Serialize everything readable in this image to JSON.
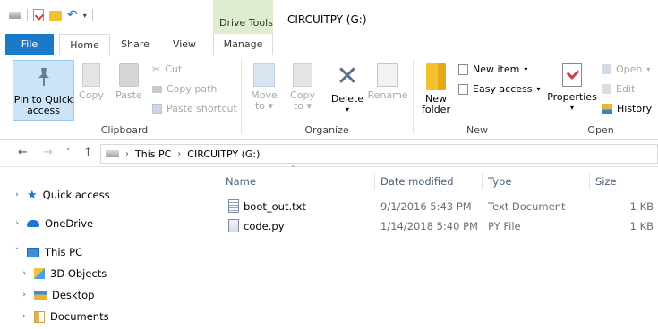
{
  "window": {
    "title": "CIRCUITPY (G:)",
    "context_tab_group": "Drive Tools"
  },
  "tabs": {
    "file": "File",
    "home": "Home",
    "share": "Share",
    "view": "View",
    "manage": "Manage"
  },
  "ribbon": {
    "clipboard": {
      "label": "Clipboard",
      "pin_line1": "Pin to Quick",
      "pin_line2": "access",
      "copy": "Copy",
      "paste": "Paste",
      "cut": "Cut",
      "copy_path": "Copy path",
      "paste_shortcut": "Paste shortcut"
    },
    "organize": {
      "label": "Organize",
      "move_line1": "Move",
      "move_line2": "to",
      "copy_line1": "Copy",
      "copy_line2": "to",
      "delete": "Delete",
      "rename": "Rename"
    },
    "new": {
      "label": "New",
      "new_folder_line1": "New",
      "new_folder_line2": "folder",
      "new_item": "New item",
      "easy_access": "Easy access"
    },
    "open": {
      "label": "Open",
      "properties": "Properties",
      "open": "Open",
      "edit": "Edit",
      "history": "History"
    }
  },
  "address": {
    "segments": [
      "This PC",
      "CIRCUITPY (G:)"
    ]
  },
  "nav_pane": {
    "items": [
      {
        "label": "Quick access",
        "icon": "star-icon"
      },
      {
        "label": "OneDrive",
        "icon": "cloud-icon"
      },
      {
        "label": "This PC",
        "icon": "computer-icon"
      },
      {
        "label": "3D Objects",
        "icon": "3d-objects-icon"
      },
      {
        "label": "Desktop",
        "icon": "desktop-folder-icon"
      },
      {
        "label": "Documents",
        "icon": "documents-folder-icon"
      }
    ]
  },
  "file_list": {
    "columns": {
      "name": "Name",
      "date": "Date modified",
      "type": "Type",
      "size": "Size"
    },
    "rows": [
      {
        "name": "boot_out.txt",
        "date": "9/1/2016 5:43 PM",
        "type": "Text Document",
        "size": "1 KB"
      },
      {
        "name": "code.py",
        "date": "1/14/2018 5:40 PM",
        "type": "PY File",
        "size": "1 KB"
      }
    ]
  },
  "colors": {
    "file_tab": "#1979ca",
    "drive_tools": "#dfeccd",
    "selected_button": "#cce4f7"
  }
}
